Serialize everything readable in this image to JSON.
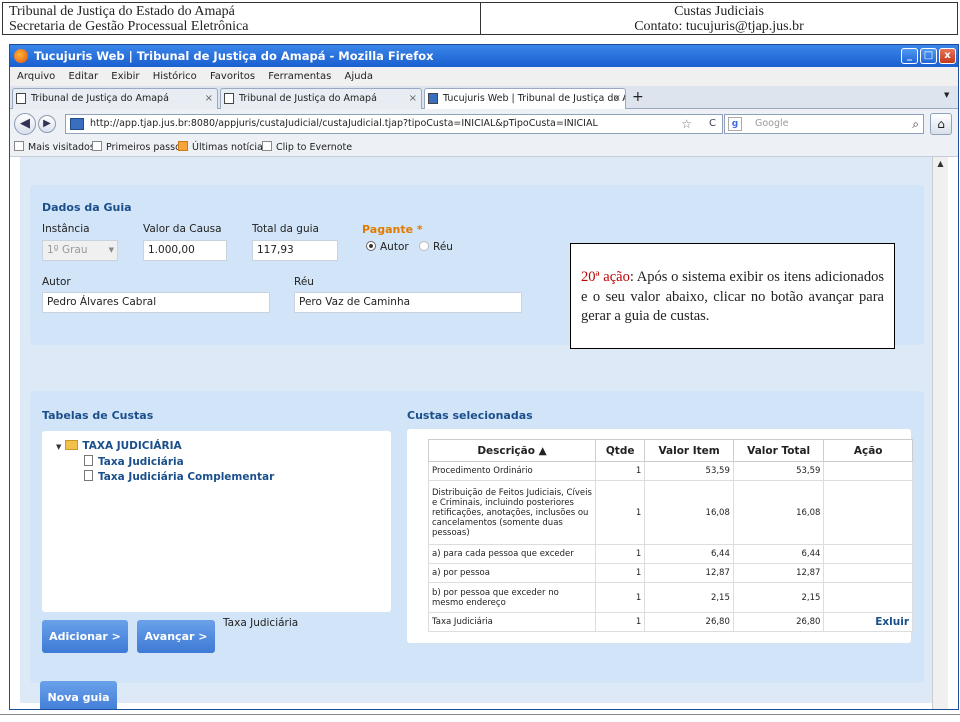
{
  "doc_header": {
    "left_line1": "Tribunal de Justiça do Estado do Amapá",
    "left_line2": "Secretaria de Gestão Processual Eletrônica",
    "right_line1": "Custas Judiciais",
    "right_line2": "Contato: tucujuris@tjap.jus.br"
  },
  "window": {
    "title": "Tucujuris Web | Tribunal de Justiça do Amapá - Mozilla Firefox",
    "minimize": "_",
    "maximize": "□",
    "close": "x"
  },
  "menu": [
    "Arquivo",
    "Editar",
    "Exibir",
    "Histórico",
    "Favoritos",
    "Ferramentas",
    "Ajuda"
  ],
  "tabs": [
    {
      "label": "Tribunal de Justiça do Amapá",
      "close": "×"
    },
    {
      "label": "Tribunal de Justiça do Amapá",
      "close": "×"
    },
    {
      "label": "Tucujuris Web | Tribunal de Justiça do A...",
      "close": "×"
    }
  ],
  "new_tab": "+",
  "nav": {
    "back": "◀",
    "forward": "▶",
    "url": "http://app.tjap.jus.br:8080/appjuris/custaJudicial/custaJudicial.tjap?tipoCusta=INICIAL&pTipoCusta=INICIAL",
    "star": "☆",
    "reload": "C",
    "search_placeholder": "Google",
    "search_logo": "g",
    "search_go": "⌕",
    "home": "⌂"
  },
  "bookmarks": [
    "Mais visitados",
    "Primeiros passos",
    "Últimas notícias",
    "Clip to Evernote"
  ],
  "guia": {
    "section_title": "Dados da Guia",
    "instancia_label": "Instância",
    "instancia_value": "1º Grau",
    "valor_causa_label": "Valor da Causa",
    "valor_causa_value": "1.000,00",
    "total_label": "Total da guia",
    "total_value": "117,93",
    "pagante_label": "Pagante",
    "pagante_req": "*",
    "opt_autor": "Autor",
    "opt_reu": "Réu",
    "autor_label": "Autor",
    "autor_value": "Pedro Álvares Cabral",
    "reu_label": "Réu",
    "reu_value": "Pero Vaz de Caminha"
  },
  "tabelas": {
    "title": "Tabelas de Custas",
    "tree_root": "TAXA JUDICIÁRIA",
    "tree_children": [
      "Taxa Judiciária",
      "Taxa Judiciária Complementar"
    ],
    "selected_label": "Taxa Judiciária",
    "btn_adicionar": "Adicionar >",
    "btn_avancar": "Avançar >"
  },
  "custas": {
    "title": "Custas selecionadas",
    "headers": [
      "Descrição ▲",
      "Qtde",
      "Valor Item",
      "Valor Total",
      "Ação"
    ],
    "rows": [
      {
        "desc": "Procedimento Ordinário",
        "qtde": "1",
        "item": "53,59",
        "total": "53,59",
        "acao": ""
      },
      {
        "desc": "Distribuição de Feitos Judiciais, Cíveis e Criminais, incluindo posteriores retificações, anotações, inclusões ou cancelamentos (somente duas pessoas)",
        "qtde": "1",
        "item": "16,08",
        "total": "16,08",
        "acao": ""
      },
      {
        "desc": "a) para cada pessoa que exceder",
        "qtde": "1",
        "item": "6,44",
        "total": "6,44",
        "acao": ""
      },
      {
        "desc": "a) por pessoa",
        "qtde": "1",
        "item": "12,87",
        "total": "12,87",
        "acao": ""
      },
      {
        "desc": "b) por pessoa que exceder no mesmo endereço",
        "qtde": "1",
        "item": "2,15",
        "total": "2,15",
        "acao": ""
      },
      {
        "desc": "Taxa Judiciária",
        "qtde": "1",
        "item": "26,80",
        "total": "26,80",
        "acao": "Exluir"
      }
    ]
  },
  "nova_guia": "Nova guia",
  "callout": {
    "step": "20ª",
    "action_word": "ação",
    "text": ": Após o sistema exibir os itens adicionados e o seu valor abaixo, clicar no botão avançar para gerar a guia de custas."
  }
}
